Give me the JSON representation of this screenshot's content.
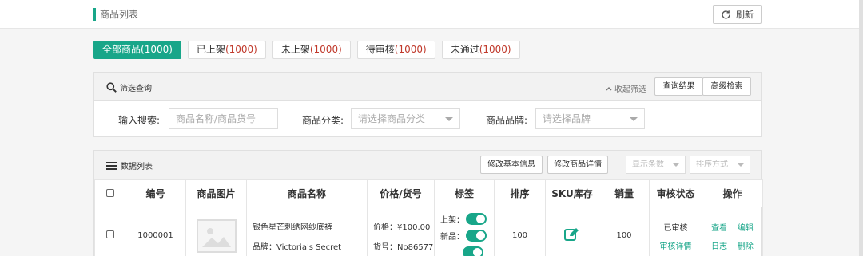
{
  "header": {
    "title": "商品列表",
    "refresh_label": "刷新"
  },
  "tabs": [
    {
      "label": "全部商品",
      "count": "(1000)",
      "active": true
    },
    {
      "label": "已上架",
      "count": "(1000)",
      "active": false
    },
    {
      "label": "未上架",
      "count": "(1000)",
      "active": false
    },
    {
      "label": "待审核",
      "count": "(1000)",
      "active": false
    },
    {
      "label": "未通过",
      "count": "(1000)",
      "active": false
    }
  ],
  "filter": {
    "title": "筛选查询",
    "collapse_label": "收起筛选",
    "query_label": "查询结果",
    "advanced_label": "高级检索",
    "search_label": "输入搜索:",
    "search_placeholder": "商品名称/商品货号",
    "category_label": "商品分类:",
    "category_placeholder": "请选择商品分类",
    "brand_label": "商品品牌:",
    "brand_placeholder": "请选择品牌"
  },
  "list": {
    "title": "数据列表",
    "edit_basic_label": "修改基本信息",
    "edit_detail_label": "修改商品详情",
    "page_size_placeholder": "显示条数",
    "sort_placeholder": "排序方式",
    "columns": [
      "编号",
      "商品图片",
      "商品名称",
      "价格/货号",
      "标签",
      "排序",
      "SKU库存",
      "销量",
      "审核状态",
      "操作"
    ],
    "rows": [
      {
        "id": "1000001",
        "name": "银色星芒刺绣网纱底裤",
        "brand": "品牌：Victoria's Secret",
        "price": "价格：¥100.00",
        "sku_no": "货号：No86577",
        "tag_on_shelf": "上架：",
        "tag_new": "新品：",
        "sort": "100",
        "sales": "100",
        "status": "已审核",
        "status_detail": "审核详情",
        "actions": {
          "view": "查看",
          "edit": "编辑",
          "log": "日志",
          "delete": "删除"
        }
      }
    ]
  },
  "colors": {
    "accent": "#18a689",
    "count": "#c0392b"
  }
}
